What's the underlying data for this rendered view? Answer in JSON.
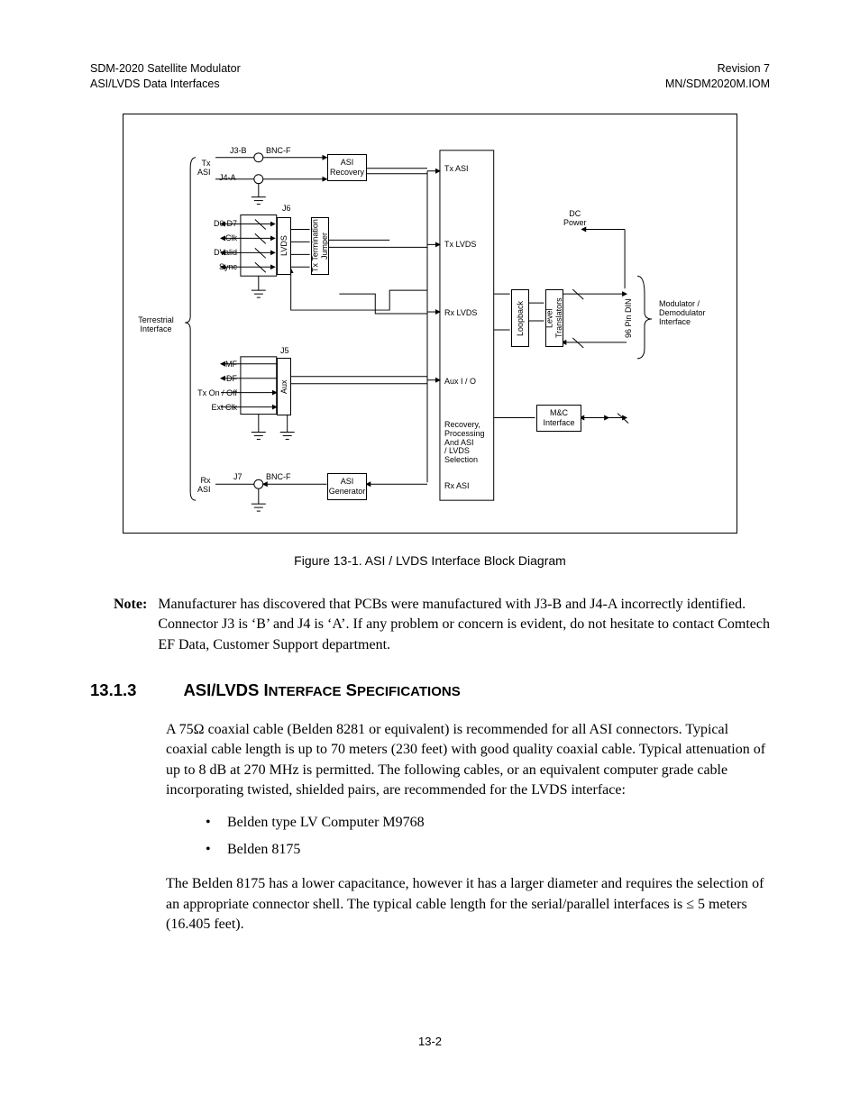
{
  "header": {
    "topLeft1": "SDM-2020 Satellite Modulator",
    "topLeft2": "ASI/LVDS Data Interfaces",
    "topRight1": "Revision 7",
    "topRight2": "MN/SDM2020M.IOM"
  },
  "figure": {
    "caption": "Figure 13-1. ASI / LVDS Interface Block Diagram",
    "labels": {
      "terrestrial": "Terrestrial\nInterface",
      "txAsiLeft": "Tx\nASI",
      "j3b": "J3-B",
      "j4a": "J4-A",
      "bncf1": "BNC-F",
      "j6": "J6",
      "d0d7": "D0-D7",
      "clk": "Clk",
      "dvalid": "DValid",
      "sync": "Sync",
      "lvds": "LVDS",
      "txTerm": "Tx Termination\nJumper",
      "rxLvds": "Rx LVDS",
      "txLvds": "Tx LVDS",
      "txAsi": "Tx ASI",
      "asiRecovery": "ASI\nRecovery",
      "dcPower": "DC\nPower",
      "loopback": "Loopback",
      "levelTrans": "Level\nTranslators",
      "pin96": "96 Pin DIN",
      "modDemod": "Modulator /\nDemodulator\nInterface",
      "j5": "J5",
      "mf": "MF",
      "df": "DF",
      "txon": "Tx On / Off",
      "extclk": "Ext Clk",
      "aux": "Aux",
      "auxio": "Aux I / O",
      "mcInterface": "M&C\nInterface",
      "recovery": "Recovery,\nProcessing\nAnd ASI\n/ LVDS\nSelection",
      "rxAsiLeft": "Rx\nASI",
      "j7": "J7",
      "bncf2": "BNC-F",
      "asiGen": "ASI\nGenerator",
      "rxAsi": "Rx ASI"
    }
  },
  "note": {
    "label": "Note:",
    "text": "Manufacturer has discovered that PCBs were manufactured with J3-B and J4-A incorrectly identified. Connector J3 is ‘B’ and J4 is ‘A’. If any problem or concern is evident, do not hesitate to contact Comtech EF Data, Customer Support department."
  },
  "section": {
    "number": "13.1.3",
    "title": "ASI/LVDS Interface Specifications",
    "titleUpper": "ASI/LVDS I",
    "titleSmall1": "NTERFACE",
    "titleUpper2": " S",
    "titleSmall2": "PECIFICATIONS"
  },
  "paragraphs": {
    "p1": "A 75Ω coaxial cable (Belden 8281 or equivalent) is recommended for all ASI connectors. Typical coaxial cable length is up to 70 meters (230 feet) with good quality coaxial cable. Typical attenuation of up to 8 dB at 270 MHz is permitted. The following cables, or an equivalent computer grade cable incorporating twisted, shielded pairs, are recommended for the LVDS interface:",
    "p2": "The Belden 8175 has a lower capacitance, however it has a larger diameter and requires the selection of an appropriate connector shell. The typical cable length for the serial/parallel interfaces is ≤ 5 meters (16.405 feet)."
  },
  "cables": {
    "c1": "Belden type LV Computer M9768",
    "c2": "Belden 8175"
  },
  "pageNumber": "13-2"
}
